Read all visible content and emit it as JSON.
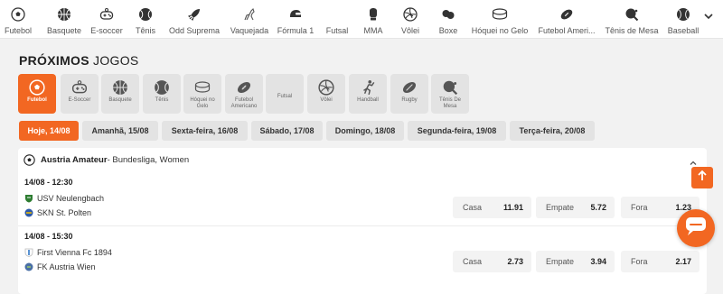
{
  "top_nav": {
    "items": [
      {
        "label": "Futebol",
        "icon": "soccer-ball-icon"
      },
      {
        "label": "Basquete",
        "icon": "basketball-icon"
      },
      {
        "label": "E-soccer",
        "icon": "gamepad-icon"
      },
      {
        "label": "Tênis",
        "icon": "tennis-ball-icon"
      },
      {
        "label": "Odd Suprema",
        "icon": "rocket-icon"
      },
      {
        "label": "Vaquejada",
        "icon": "horse-icon"
      },
      {
        "label": "Fórmula 1",
        "icon": "racing-helmet-icon"
      },
      {
        "label": "Futsal",
        "icon": "futsal-ball-icon"
      },
      {
        "label": "MMA",
        "icon": "boxing-glove-icon"
      },
      {
        "label": "Vôlei",
        "icon": "volleyball-icon"
      },
      {
        "label": "Boxe",
        "icon": "boxing-gloves-icon"
      },
      {
        "label": "Hóquei no Gelo",
        "icon": "hockey-puck-icon"
      },
      {
        "label": "Futebol Ameri...",
        "icon": "american-football-icon"
      },
      {
        "label": "Tênis de Mesa",
        "icon": "table-tennis-icon"
      },
      {
        "label": "Baseball",
        "icon": "baseball-icon"
      }
    ]
  },
  "section": {
    "title_bold": "PRÓXIMOS",
    "title_rest": " JOGOS"
  },
  "sport_tiles": [
    {
      "label": "Futebol",
      "icon": "soccer-ball-icon",
      "active": true
    },
    {
      "label": "E-Soccer",
      "icon": "gamepad-icon"
    },
    {
      "label": "Basquete",
      "icon": "basketball-icon"
    },
    {
      "label": "Tênis",
      "icon": "tennis-ball-icon"
    },
    {
      "label": "Hóquei no Gelo",
      "icon": "hockey-puck-icon"
    },
    {
      "label": "Futebol Americano",
      "icon": "american-football-icon"
    },
    {
      "label": "Futsal",
      "icon": ""
    },
    {
      "label": "Vôlei",
      "icon": "volleyball-icon"
    },
    {
      "label": "Handball",
      "icon": "handball-icon"
    },
    {
      "label": "Rugby",
      "icon": "rugby-ball-icon"
    },
    {
      "label": "Tênis De Mesa",
      "icon": "table-tennis-icon"
    }
  ],
  "date_tabs": [
    {
      "label": "Hoje, 14/08",
      "active": true
    },
    {
      "label": "Amanhã, 15/08"
    },
    {
      "label": "Sexta-feira, 16/08"
    },
    {
      "label": "Sábado, 17/08"
    },
    {
      "label": "Domingo, 18/08"
    },
    {
      "label": "Segunda-feira, 19/08"
    },
    {
      "label": "Terça-feira, 20/08"
    }
  ],
  "league": {
    "name": "Austria Amateur",
    "sub": " - Bundesliga, Women"
  },
  "matches": [
    {
      "time": "14/08 - 12:30",
      "home": "USV Neulengbach",
      "away": "SKN St. Polten",
      "odds": [
        {
          "label": "Casa",
          "value": "11.91"
        },
        {
          "label": "Empate",
          "value": "5.72"
        },
        {
          "label": "Fora",
          "value": "1.23"
        }
      ]
    },
    {
      "time": "14/08 - 15:30",
      "home": "First Vienna Fc 1894",
      "away": "FK Austria Wien",
      "odds": [
        {
          "label": "Casa",
          "value": "2.73"
        },
        {
          "label": "Empate",
          "value": "3.94"
        },
        {
          "label": "Fora",
          "value": "2.17"
        }
      ]
    }
  ],
  "colors": {
    "accent": "#f26722",
    "background": "#f2f2f2"
  }
}
